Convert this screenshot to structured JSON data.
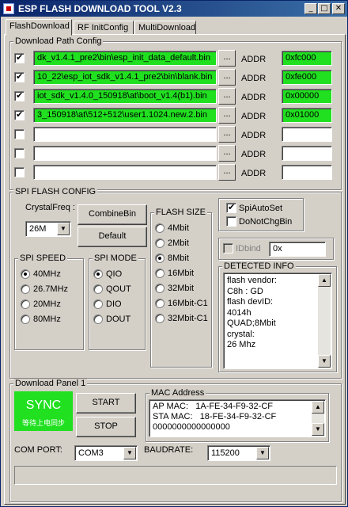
{
  "window": {
    "title": "ESP FLASH DOWNLOAD TOOL V2.3"
  },
  "tabs": [
    {
      "label": "FlashDownload"
    },
    {
      "label": "RF InitConfig"
    },
    {
      "label": "MultiDownload"
    }
  ],
  "download_path": {
    "label": "Download Path Config",
    "dots_label": "...",
    "addr_label": "ADDR",
    "rows": [
      {
        "checked": true,
        "path": "dk_v1.4.1_pre2\\bin\\esp_init_data_default.bin",
        "addr": "0xfc000"
      },
      {
        "checked": true,
        "path": "10_22\\esp_iot_sdk_v1.4.1_pre2\\bin\\blank.bin",
        "addr": "0xfe000"
      },
      {
        "checked": true,
        "path": "iot_sdk_v1.4.0_150918\\at\\boot_v1.4(b1).bin",
        "addr": "0x00000"
      },
      {
        "checked": true,
        "path": "3_150918\\at\\512+512\\user1.1024.new.2.bin",
        "addr": "0x01000"
      },
      {
        "checked": false,
        "path": "",
        "addr": ""
      },
      {
        "checked": false,
        "path": "",
        "addr": ""
      },
      {
        "checked": false,
        "path": "",
        "addr": ""
      }
    ]
  },
  "spi_config": {
    "label": "SPI FLASH CONFIG",
    "crystal_label": "CrystalFreq :",
    "crystal_value": "26M",
    "combine_button": "CombineBin",
    "default_button": "Default",
    "speed": {
      "label": "SPI SPEED",
      "options": [
        "40MHz",
        "26.7MHz",
        "20MHz",
        "80MHz"
      ],
      "selected": 0
    },
    "mode": {
      "label": "SPI MODE",
      "options": [
        "QIO",
        "QOUT",
        "DIO",
        "DOUT"
      ],
      "selected": 0
    },
    "size": {
      "label": "FLASH SIZE",
      "options": [
        "4Mbit",
        "2Mbit",
        "8Mbit",
        "16Mbit",
        "32Mbit",
        "16Mbit-C1",
        "32Mbit-C1"
      ],
      "selected": 2
    },
    "spi_auto_set": {
      "label": "SpiAutoSet",
      "checked": true
    },
    "do_not_chg_bin": {
      "label": "DoNotChgBin",
      "checked": false
    },
    "idbind": {
      "label": "IDbind",
      "value": "0x"
    },
    "detected": {
      "label": "DETECTED INFO",
      "lines": [
        "flash vendor:",
        "C8h : GD",
        "flash devID:",
        "4014h",
        "QUAD;8Mbit",
        "crystal:",
        "26 Mhz"
      ]
    }
  },
  "download_panel": {
    "label": "Download Panel 1",
    "sync_text": "SYNC",
    "sync_subtext": "等待上电同步",
    "start_button": "START",
    "stop_button": "STOP",
    "mac": {
      "label": "MAC Address",
      "lines": [
        "AP MAC:   1A-FE-34-F9-32-CF",
        "STA MAC:   18-FE-34-F9-32-CF",
        "0000000000000000"
      ]
    },
    "com_port_label": "COM PORT:",
    "com_port_value": "COM3",
    "baudrate_label": "BAUDRATE:",
    "baudrate_value": "115200"
  },
  "colors": {
    "sync_bg": "#20e020",
    "path_bg": "#20e020",
    "titlebar": "#0a246a"
  }
}
